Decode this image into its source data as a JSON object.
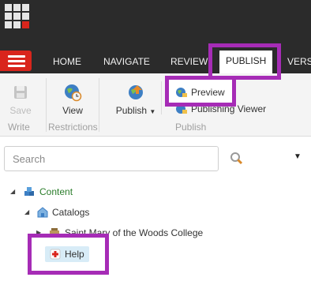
{
  "topbar": {
    "launcher_icon": "app-grid-icon"
  },
  "tabs": [
    {
      "label": "HOME"
    },
    {
      "label": "NAVIGATE"
    },
    {
      "label": "REVIEW"
    },
    {
      "label": "PUBLISH",
      "active": true
    },
    {
      "label": "VERSI"
    }
  ],
  "ribbon": {
    "save": {
      "label_line1": "Save",
      "label_line2": "Write",
      "icon": "floppy-disk-icon"
    },
    "restrictions": {
      "label": "View",
      "group": "Restrictions",
      "icon": "globe-clock-icon"
    },
    "publish_group": {
      "publish_button": "Publish",
      "preview_button": "Preview",
      "publishing_viewer_partial": "Publishing Viewer",
      "group": "Publish"
    }
  },
  "search": {
    "placeholder": "Search",
    "icon": "search-icon"
  },
  "tree": {
    "content": "Content",
    "catalogs": "Catalogs",
    "college": "Saint Mary of the Woods College",
    "help": "Help"
  },
  "colors": {
    "highlight": "#a62cb6",
    "brand_red": "#d9251c",
    "dark_bar": "#2b2b2b"
  }
}
